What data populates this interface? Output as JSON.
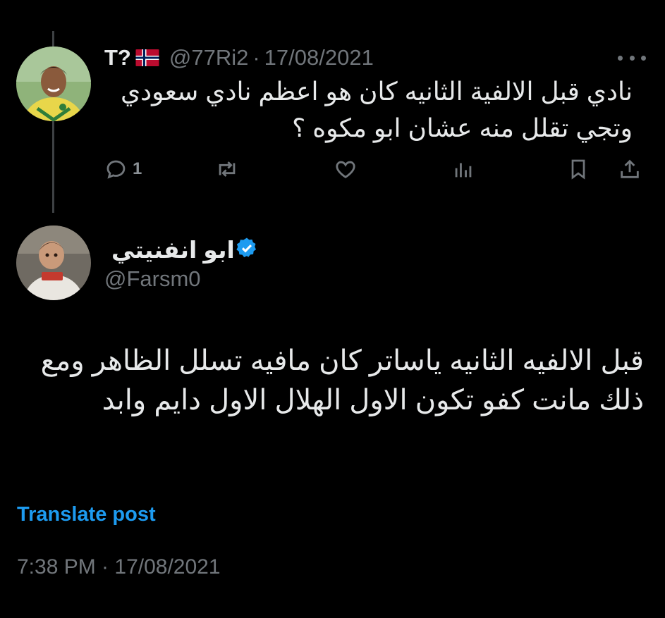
{
  "parent_tweet": {
    "display_name": "T?",
    "flag_icon": "norway-flag-icon",
    "handle": "@77Ri2",
    "separator": "·",
    "date": "17/08/2021",
    "text": "نادي قبل الالفية الثانيه كان هو اعظم نادي سعودي وتجي تقلل منه عشان ابو مكوه ؟",
    "actions": {
      "reply_count": "1"
    }
  },
  "reply_tweet": {
    "display_name": "ابو انفنيتي",
    "verified_icon": "verified-badge-icon",
    "handle": "@Farsm0",
    "text": "قبل الالفيه الثانيه ياساتر كان مافيه تسلل الظاهر ومع ذلك مانت كفو تكون الاول الهلال الاول دايم وابد",
    "translate_label": "Translate post",
    "timestamp": "7:38 PM · 17/08/2021"
  },
  "colors": {
    "background": "#000000",
    "primary_text": "#e7e9ea",
    "secondary_text": "#71767b",
    "accent": "#1d9bf0"
  }
}
